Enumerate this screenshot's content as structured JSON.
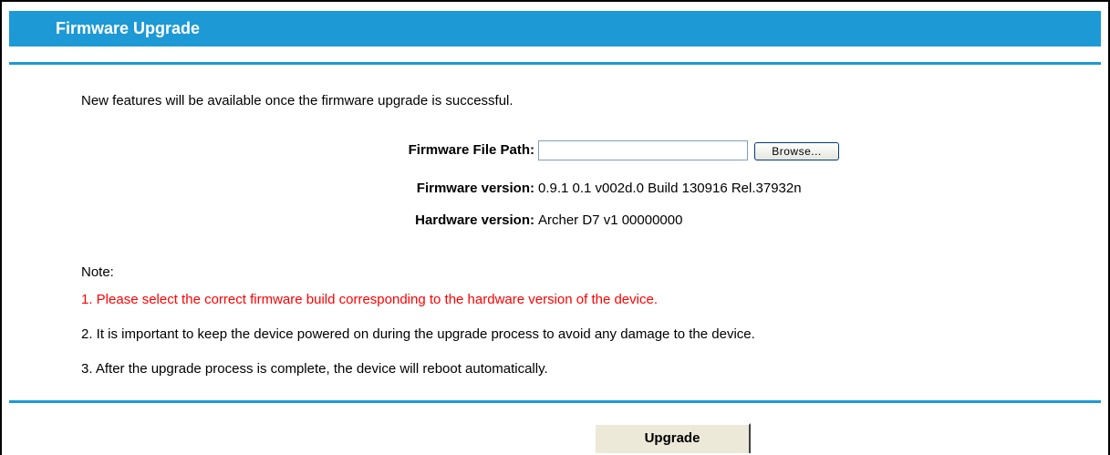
{
  "header": {
    "title": "Firmware Upgrade"
  },
  "intro": "New features will be available once the firmware upgrade is successful.",
  "form": {
    "file_path_label": "Firmware File Path:",
    "file_path_value": "",
    "browse_label": "Browse...",
    "firmware_version_label": "Firmware version:",
    "firmware_version_value": "0.9.1 0.1 v002d.0 Build 130916 Rel.37932n",
    "hardware_version_label": "Hardware version:",
    "hardware_version_value": "Archer D7 v1 00000000"
  },
  "notes": {
    "title": "Note:",
    "items": [
      "1. Please select the correct firmware build corresponding to the hardware version of the device.",
      "2. It is important to keep the device powered on during the upgrade process to avoid any damage to the device.",
      "3. After the upgrade process is complete, the device will reboot automatically."
    ]
  },
  "actions": {
    "upgrade_label": "Upgrade"
  },
  "colors": {
    "accent": "#1d99d6",
    "warning_text": "#ff0000"
  }
}
